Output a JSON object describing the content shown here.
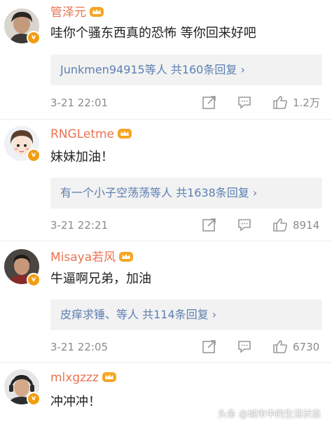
{
  "comments": [
    {
      "username": "管泽元",
      "text": "哇你个骚东西真的恐怖 等你回来好吧",
      "replies": "Junkmen94915等人 共160条回复 ›",
      "time": "3-21 22:01",
      "likes": "1.2万"
    },
    {
      "username": "RNGLetme",
      "text": "妹妹加油！",
      "replies": "有一个小子空荡荡等人 共1638条回复 ›",
      "time": "3-21 22:21",
      "likes": "8914"
    },
    {
      "username": "Misaya若风",
      "text": "牛逼啊兄弟，加油",
      "replies": "皮痒求锤、等人 共114条回复 ›",
      "time": "3-21 22:05",
      "likes": "6730"
    },
    {
      "username": "mlxgzzz",
      "text": "冲冲冲！"
    }
  ],
  "icons": {
    "verified": "verified-badge-icon",
    "vip": "crown-vip-icon",
    "forward": "forward-icon",
    "comment": "comment-icon",
    "like": "thumbs-up-icon"
  },
  "colors": {
    "username": "#eb7350",
    "reply_link": "#5d7fb2",
    "meta": "#8b8b8b",
    "badge": "#f29d11"
  },
  "watermark": "头条 @城市中的生活状态"
}
